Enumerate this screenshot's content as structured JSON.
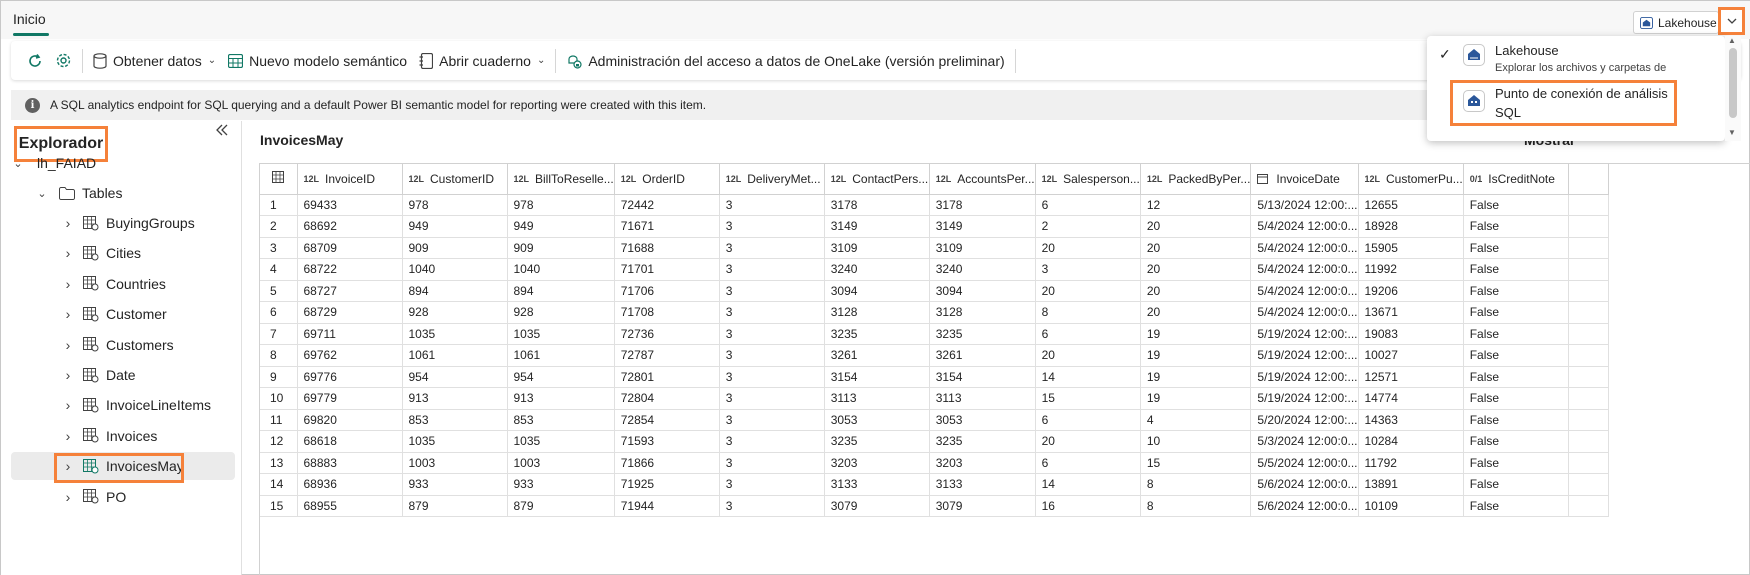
{
  "top_tab": {
    "label": "Inicio"
  },
  "mode_selector": {
    "label": "Lakehouse"
  },
  "ribbon": {
    "get_data": "Obtener datos",
    "new_semantic_model": "Nuevo modelo semántico",
    "open_notebook": "Abrir cuaderno",
    "onelake_access": "Administración del acceso a datos de OneLake (versión preliminar)"
  },
  "info_bar": {
    "text": "A SQL analytics endpoint for SQL querying and a default Power BI semantic model for reporting were created with this item."
  },
  "explorer": {
    "title": "Explorador",
    "root": "lh_FAIAD",
    "tables_folder": "Tables",
    "items": [
      "BuyingGroups",
      "Cities",
      "Countries",
      "Customer",
      "Customers",
      "Date",
      "InvoiceLineItems",
      "Invoices",
      "InvoicesMay",
      "PO"
    ],
    "selected": "InvoicesMay"
  },
  "main": {
    "title": "InvoicesMay",
    "show_label": "Mostrar"
  },
  "popup": {
    "option1": {
      "title": "Lakehouse",
      "desc": "Explorar los archivos y carpetas de"
    },
    "option2": {
      "title_line1": "Punto de conexión de análisis",
      "title_line2": "SQL"
    }
  },
  "table": {
    "columns": [
      {
        "type": "12L",
        "name": "InvoiceID"
      },
      {
        "type": "12L",
        "name": "CustomerID"
      },
      {
        "type": "12L",
        "name": "BillToReselle..."
      },
      {
        "type": "12L",
        "name": "OrderID"
      },
      {
        "type": "12L",
        "name": "DeliveryMet..."
      },
      {
        "type": "12L",
        "name": "ContactPers..."
      },
      {
        "type": "12L",
        "name": "AccountsPer..."
      },
      {
        "type": "12L",
        "name": "Salesperson..."
      },
      {
        "type": "12L",
        "name": "PackedByPer..."
      },
      {
        "type": "cal",
        "name": "InvoiceDate"
      },
      {
        "type": "12L",
        "name": "CustomerPu..."
      },
      {
        "type": "0/1",
        "name": "IsCreditNote"
      }
    ],
    "rows": [
      [
        "1",
        "69433",
        "978",
        "978",
        "72442",
        "3",
        "3178",
        "3178",
        "6",
        "12",
        "5/13/2024 12:00:...",
        "12655",
        "False"
      ],
      [
        "2",
        "68692",
        "949",
        "949",
        "71671",
        "3",
        "3149",
        "3149",
        "2",
        "20",
        "5/4/2024 12:00:0...",
        "18928",
        "False"
      ],
      [
        "3",
        "68709",
        "909",
        "909",
        "71688",
        "3",
        "3109",
        "3109",
        "20",
        "20",
        "5/4/2024 12:00:0...",
        "15905",
        "False"
      ],
      [
        "4",
        "68722",
        "1040",
        "1040",
        "71701",
        "3",
        "3240",
        "3240",
        "3",
        "20",
        "5/4/2024 12:00:0...",
        "11992",
        "False"
      ],
      [
        "5",
        "68727",
        "894",
        "894",
        "71706",
        "3",
        "3094",
        "3094",
        "20",
        "20",
        "5/4/2024 12:00:0...",
        "19206",
        "False"
      ],
      [
        "6",
        "68729",
        "928",
        "928",
        "71708",
        "3",
        "3128",
        "3128",
        "8",
        "20",
        "5/4/2024 12:00:0...",
        "13671",
        "False"
      ],
      [
        "7",
        "69711",
        "1035",
        "1035",
        "72736",
        "3",
        "3235",
        "3235",
        "6",
        "19",
        "5/19/2024 12:00:...",
        "19083",
        "False"
      ],
      [
        "8",
        "69762",
        "1061",
        "1061",
        "72787",
        "3",
        "3261",
        "3261",
        "20",
        "19",
        "5/19/2024 12:00:...",
        "10027",
        "False"
      ],
      [
        "9",
        "69776",
        "954",
        "954",
        "72801",
        "3",
        "3154",
        "3154",
        "14",
        "19",
        "5/19/2024 12:00:...",
        "12571",
        "False"
      ],
      [
        "10",
        "69779",
        "913",
        "913",
        "72804",
        "3",
        "3113",
        "3113",
        "15",
        "19",
        "5/19/2024 12:00:...",
        "14774",
        "False"
      ],
      [
        "11",
        "69820",
        "853",
        "853",
        "72854",
        "3",
        "3053",
        "3053",
        "6",
        "4",
        "5/20/2024 12:00:...",
        "14363",
        "False"
      ],
      [
        "12",
        "68618",
        "1035",
        "1035",
        "71593",
        "3",
        "3235",
        "3235",
        "20",
        "10",
        "5/3/2024 12:00:0...",
        "10284",
        "False"
      ],
      [
        "13",
        "68883",
        "1003",
        "1003",
        "71866",
        "3",
        "3203",
        "3203",
        "6",
        "15",
        "5/5/2024 12:00:0...",
        "11792",
        "False"
      ],
      [
        "14",
        "68936",
        "933",
        "933",
        "71925",
        "3",
        "3133",
        "3133",
        "14",
        "8",
        "5/6/2024 12:00:0...",
        "13891",
        "False"
      ],
      [
        "15",
        "68955",
        "879",
        "879",
        "71944",
        "3",
        "3079",
        "3079",
        "16",
        "8",
        "5/6/2024 12:00:0...",
        "10109",
        "False"
      ]
    ]
  },
  "colors": {
    "accent": "#117865",
    "highlight": "#f5813a"
  }
}
